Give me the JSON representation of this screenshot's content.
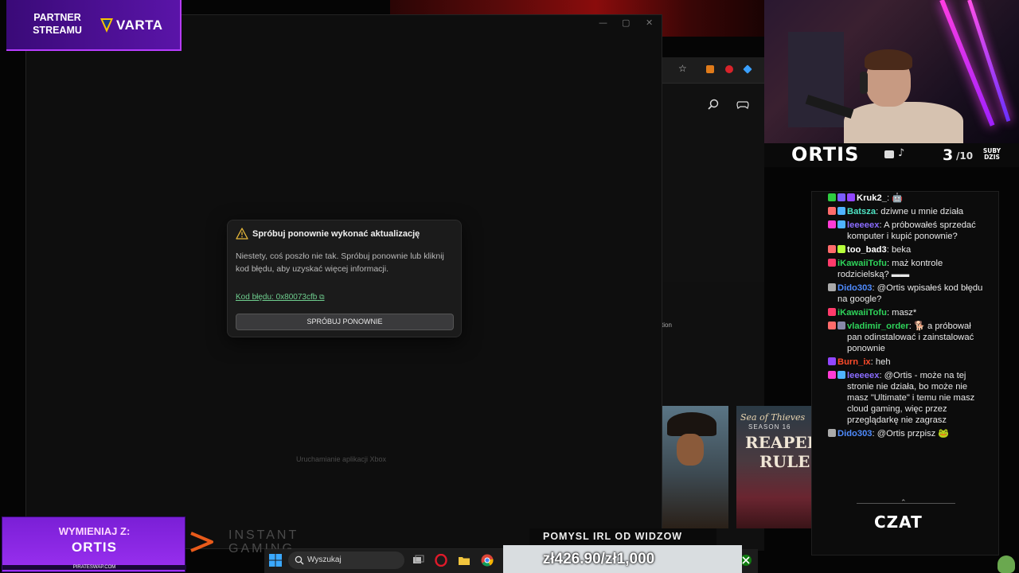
{
  "partner": {
    "label": "PARTNER STREAMU",
    "brand": "VARTA"
  },
  "streamer": {
    "name": "ORTIS",
    "subs_count": "3",
    "subs_goal": "/10",
    "subs_label": "SUBY DZIS"
  },
  "xbox_window": {
    "launching_text": "Uruchamianie aplikacji Xbox",
    "controls": {
      "minimize": "—",
      "maximize": "▢",
      "close": "✕"
    }
  },
  "dialog": {
    "title": "Spróbuj ponownie wykonać aktualizację",
    "body": "Niestety, coś poszło nie tak. Spróbuj ponownie lub kliknij kod błędu, aby uzyskać więcej informacji.",
    "error_link": "Kod błędu: 0x80073cfb",
    "retry_label": "SPRÓBUJ PONOWNIE"
  },
  "background_fragment": {
    "text": "tion"
  },
  "games": {
    "sot_title": "Sea of Thieves",
    "sot_season": "SEASON 16",
    "sot_line1": "REAPERS",
    "sot_line2": "RULE"
  },
  "chat": {
    "messages": [
      {
        "user": "Kruk2_",
        "text": "🤖",
        "color": "#ffffff",
        "badges": [
          "#2ecc40",
          "#7a5cff",
          "#9146ff"
        ]
      },
      {
        "user": "Batsza",
        "text": "dziwne u mnie działa",
        "color": "#4fe3c4",
        "badges": [
          "#ff6b6b",
          "#4fb3ff"
        ]
      },
      {
        "user": "leeeeex",
        "text": "A próbowałeś sprzedać komputer i kupić ponownie?",
        "color": "#8a6cff",
        "badges": [
          "#ff3bd6",
          "#4fb3ff"
        ]
      },
      {
        "user": "too_bad3",
        "text": "beka",
        "color": "#ffffff",
        "badges": [
          "#ff6b6b",
          "#b6ff3b"
        ]
      },
      {
        "user": "iKawaiiTofu",
        "text": "maż kontrole rodzicielską? ▬▬",
        "color": "#2ed35a",
        "badges": [
          "#ff3b6b"
        ]
      },
      {
        "user": "Dido303",
        "text": "@Ortis wpisałeś kod błędu na google?",
        "color": "#4f8bff",
        "badges": [
          "#aaaaaa"
        ]
      },
      {
        "user": "iKawaiiTofu",
        "text": "masz*",
        "color": "#2ed35a",
        "badges": [
          "#ff3b6b"
        ]
      },
      {
        "user": "vladimir_order",
        "text": "🐕 a próbował pan odinstalować i zainstalować ponownie",
        "color": "#2ed35a",
        "badges": [
          "#ff6b6b",
          "#8888aa"
        ]
      },
      {
        "user": "Burn_ix",
        "text": "heh",
        "color": "#ff4b2b",
        "badges": [
          "#9146ff"
        ]
      },
      {
        "user": "leeeeex",
        "text": "@Ortis - może na tej stronie nie działa, bo może nie masz \"Ultimate\" i temu nie masz cloud gaming, więc przez przeglądarkę nie zagrasz",
        "color": "#8a6cff",
        "badges": [
          "#ff3bd6",
          "#4fb3ff"
        ]
      },
      {
        "user": "Dido303",
        "text": "@Ortis przpisz 🐸",
        "color": "#4f8bff",
        "badges": [
          "#aaaaaa"
        ]
      }
    ],
    "label": "CZAT"
  },
  "exchange": {
    "label": "WYMIENIAJ Z:",
    "name": "ORTIS",
    "site": "PIRATESWAP.COM"
  },
  "instant_gaming": {
    "line1": "INSTANT",
    "line2": "GAMING"
  },
  "donation": {
    "label": "POMYSL IRL OD WIDZOW",
    "progress": "zł426.90/zł1,000"
  },
  "taskbar": {
    "search_placeholder": "Wyszukaj"
  }
}
